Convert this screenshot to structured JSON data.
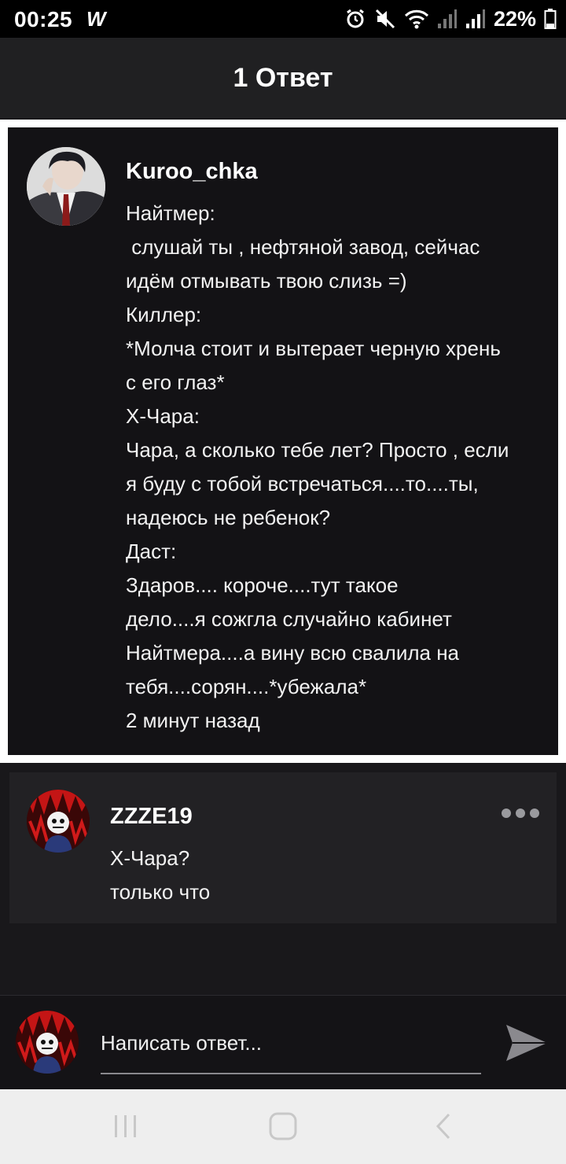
{
  "status_bar": {
    "time": "00:25",
    "app_icon": "W",
    "battery": "22%",
    "icons": [
      "alarm-icon",
      "mute-icon",
      "wifi-icon",
      "signal-icon",
      "signal-icon",
      "battery-icon"
    ]
  },
  "header": {
    "title": "1 Ответ"
  },
  "post": {
    "username": "Kuroo_chka",
    "lines": [
      "Найтмер:",
      " слушай ты , нефтяной завод, сейчас",
      "идём отмывать твою слизь =)",
      "Киллер:",
      "*Молча стоит и вытерает черную хрень",
      "с его глаз*",
      "X-Чара:",
      "Чара, а сколько тебе лет? Просто , если",
      "я буду с тобой встречаться....то....ты,",
      "надеюсь не ребенок?",
      "Даст:",
      "Здаров.... короче....тут такое",
      "дело....я сожгла случайно кабинет",
      "Найтмера....а вину всю свалила на",
      "тебя....сорян....*убежала*"
    ],
    "timestamp": "2 минут назад"
  },
  "reply": {
    "username": "ZZZE19",
    "text": "X-Чара?",
    "timestamp": "только что"
  },
  "composer": {
    "placeholder": "Написать ответ..."
  },
  "colors": {
    "background": "#19181b",
    "card": "#131215",
    "reply_card": "#222124",
    "header": "#202022"
  }
}
